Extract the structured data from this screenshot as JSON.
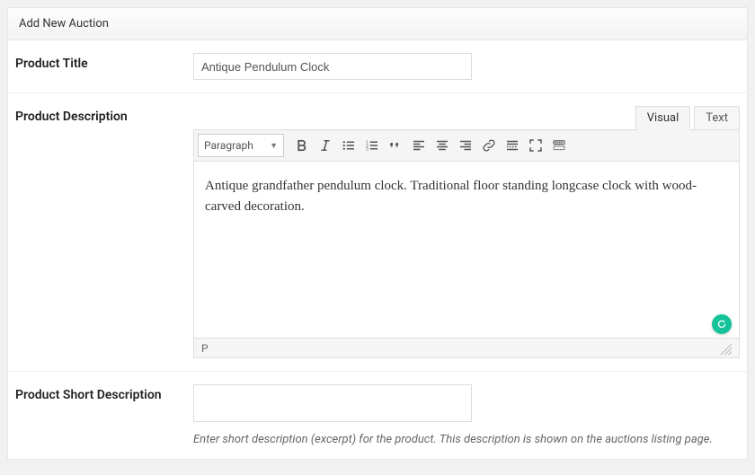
{
  "panel": {
    "title": "Add New Auction"
  },
  "labels": {
    "product_title": "Product Title",
    "product_description": "Product Description",
    "product_short_description": "Product Short Description"
  },
  "product": {
    "title": "Antique Pendulum Clock",
    "description": "Antique grandfather pendulum clock. Traditional floor standing longcase clock with wood-carved decoration.",
    "short_description": ""
  },
  "editor": {
    "tabs": {
      "visual": "Visual",
      "text": "Text"
    },
    "format_selector": "Paragraph",
    "status_path": "P"
  },
  "hints": {
    "short_description": "Enter short description (excerpt) for the product. This description is shown on the auctions listing page."
  }
}
